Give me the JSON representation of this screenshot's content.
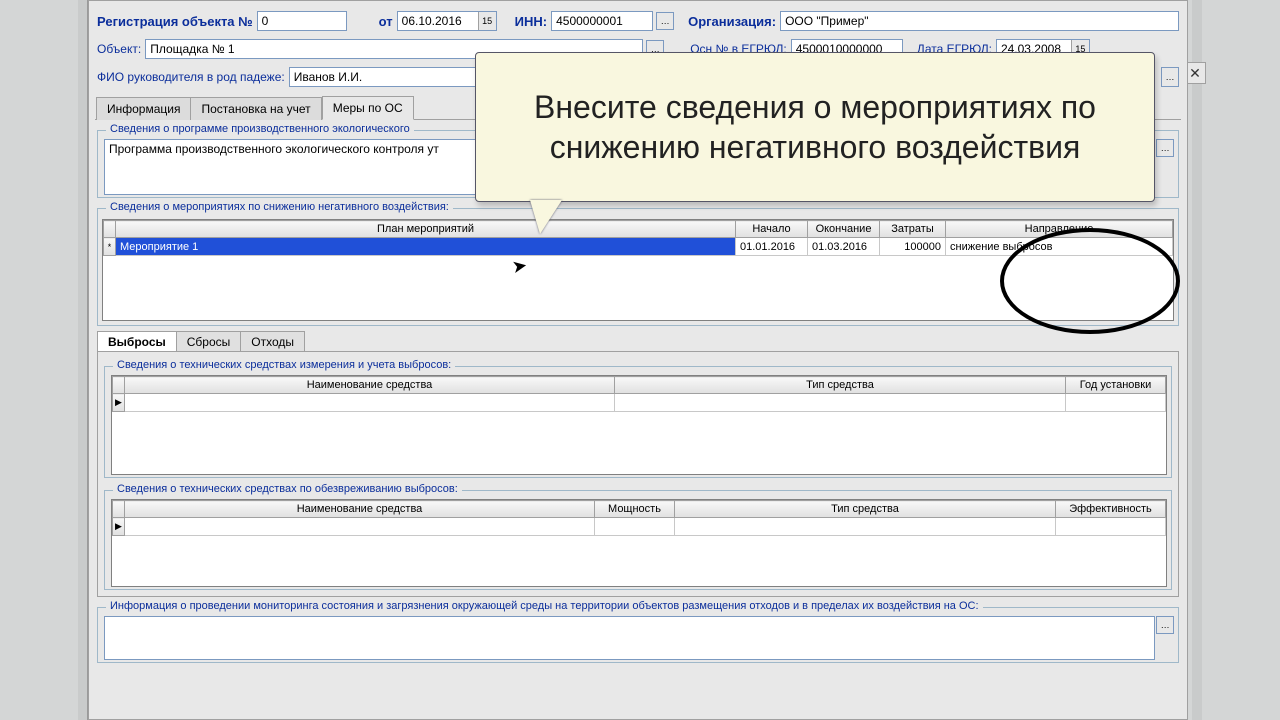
{
  "header": {
    "title_prefix": "Регистрация объекта №",
    "reg_no": "0",
    "ot_label": "от",
    "reg_date": "06.10.2016",
    "inn_label": "ИНН:",
    "inn": "4500000001",
    "org_label": "Организация:",
    "org": "ООО \"Пример\""
  },
  "row2": {
    "object_label": "Объект:",
    "object": "Площадка № 1",
    "osn_label": "Осн № в ЕГРЮЛ:",
    "osn": "4500010000000",
    "egrjul_date_label": "Дата ЕГРЮЛ:",
    "egrjul_date": "24.03.2008"
  },
  "row3": {
    "fio_label": "ФИО руководителя в род падеже:",
    "fio": "Иванов И.И."
  },
  "main_tabs": [
    "Информация",
    "Постановка на учет",
    "Меры по ОС"
  ],
  "group1": {
    "title": "Сведения о программе производственного экологического",
    "text": "Программа производственного экологического контроля ут"
  },
  "group2": {
    "title": "Сведения о мероприятиях по снижению негативного воздействия:",
    "columns": [
      "План мероприятий",
      "Начало",
      "Окончание",
      "Затраты",
      "Направление"
    ],
    "row": {
      "plan": "Мероприятие 1",
      "start": "01.01.2016",
      "end": "01.03.2016",
      "cost": "100000",
      "dir": "снижение выбросов"
    }
  },
  "sub_tabs": [
    "Выбросы",
    "Сбросы",
    "Отходы"
  ],
  "group3": {
    "title": "Сведения о технических средствах измерения и учета выбросов:",
    "columns": [
      "Наименование средства",
      "Тип средства",
      "Год установки"
    ]
  },
  "group4": {
    "title": "Сведения о технических средствах по обезвреживанию выбросов:",
    "columns": [
      "Наименование средства",
      "Мощность",
      "Тип средства",
      "Эффективность"
    ]
  },
  "group5": {
    "title": "Информация о проведении мониторинга состояния и загрязнения окружающей среды на территории объектов размещения отходов и в пределах их воздействия на ОС:"
  },
  "tooltip": "Внесите сведения о мероприятиях по снижению негативного воздействия",
  "icons": {
    "calendar": "📅"
  }
}
